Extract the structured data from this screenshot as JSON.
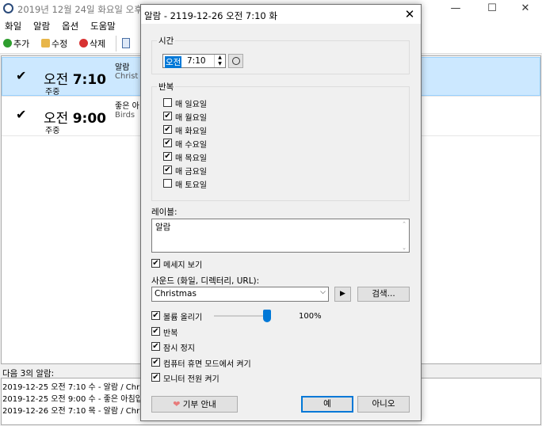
{
  "main": {
    "title": "2019년 12월 24일 화요일 오후",
    "menu": [
      "화일",
      "알람",
      "옵션",
      "도움말"
    ],
    "toolbar": {
      "add": "추가",
      "edit": "수정",
      "delete": "삭제"
    },
    "controls": {
      "minimize": "—",
      "maximize": "☐",
      "close": "✕"
    },
    "alarms": [
      {
        "checked": "✔",
        "ampm": "오전",
        "time": "7:10",
        "repeat": "주중",
        "label": "알람",
        "desc": "Christ"
      },
      {
        "checked": "✔",
        "ampm": "오전",
        "time": "9:00",
        "repeat": "주중",
        "label": "좋은 아",
        "desc": "Birds"
      }
    ],
    "next_label": "다음 3의 알람:",
    "next_alarms": [
      "2019-12-25 오전 7:10 수 - 알람 / Christ",
      "2019-12-25 오전 9:00 수 - 좋은 아침입",
      "2019-12-26 오전 7:10 목 - 알람 / Christ"
    ]
  },
  "dialog": {
    "title": "알람 - 2119-12-26 오전 7:10 화",
    "time_group": "시간",
    "ampm": "오전",
    "time": "7:10",
    "repeat_group": "반복",
    "days": [
      {
        "label": "매 일요일",
        "checked": false
      },
      {
        "label": "매 월요일",
        "checked": true
      },
      {
        "label": "매 화요일",
        "checked": true
      },
      {
        "label": "매 수요일",
        "checked": true
      },
      {
        "label": "매 목요일",
        "checked": true
      },
      {
        "label": "매 금요일",
        "checked": true
      },
      {
        "label": "매 토요일",
        "checked": false
      }
    ],
    "label_caption": "레이블:",
    "label_value": "알람",
    "show_message": "메세지 보기",
    "sound_caption": "사운드 (화일, 디렉터리, URL):",
    "sound_value": "Christmas",
    "browse": "검색...",
    "volume_label": "볼륨 올리기",
    "volume_value": "100%",
    "volume_level": 1.0,
    "options": [
      "반복",
      "잠시 정지",
      "컴퓨터 휴면 모드에서 켜기",
      "모니터 전원 켜기"
    ],
    "donate": "기부 안내",
    "yes": "예",
    "no": "아니오"
  }
}
